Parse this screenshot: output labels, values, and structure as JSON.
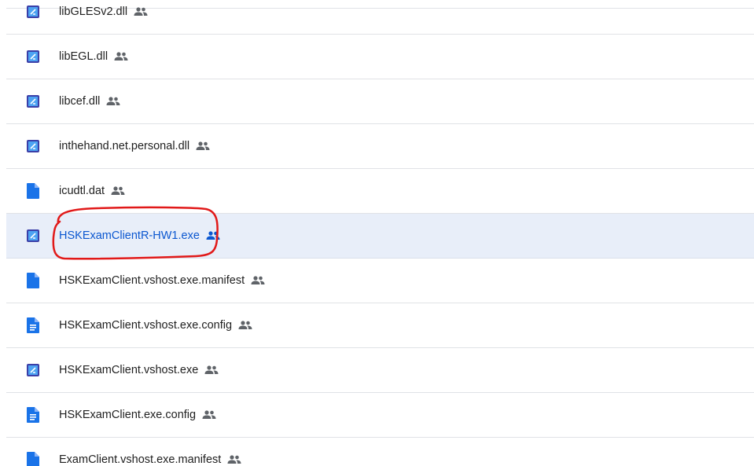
{
  "files": [
    {
      "name": "libGLESv2.dll",
      "type": "exe-dll",
      "shared": true,
      "selected": false
    },
    {
      "name": "libEGL.dll",
      "type": "exe-dll",
      "shared": true,
      "selected": false
    },
    {
      "name": "libcef.dll",
      "type": "exe-dll",
      "shared": true,
      "selected": false
    },
    {
      "name": "inthehand.net.personal.dll",
      "type": "exe-dll",
      "shared": true,
      "selected": false
    },
    {
      "name": "icudtl.dat",
      "type": "generic-file",
      "shared": true,
      "selected": false
    },
    {
      "name": "HSKExamClientR-HW1.exe",
      "type": "exe-dll",
      "shared": true,
      "selected": true
    },
    {
      "name": "HSKExamClient.vshost.exe.manifest",
      "type": "generic-file",
      "shared": true,
      "selected": false
    },
    {
      "name": "HSKExamClient.vshost.exe.config",
      "type": "doc-file",
      "shared": true,
      "selected": false
    },
    {
      "name": "HSKExamClient.vshost.exe",
      "type": "exe-dll",
      "shared": true,
      "selected": false
    },
    {
      "name": "HSKExamClient.exe.config",
      "type": "doc-file",
      "shared": true,
      "selected": false
    },
    {
      "name": "ExamClient.vshost.exe.manifest",
      "type": "generic-file",
      "shared": true,
      "selected": false
    }
  ],
  "colors": {
    "selected_bg": "#e8eef9",
    "selected_text": "#0b57d0",
    "file_blue": "#1a73e8",
    "exe_frame": "#3b3fa8",
    "shared_gray": "#5f6368",
    "annotation_red": "#e11919"
  }
}
